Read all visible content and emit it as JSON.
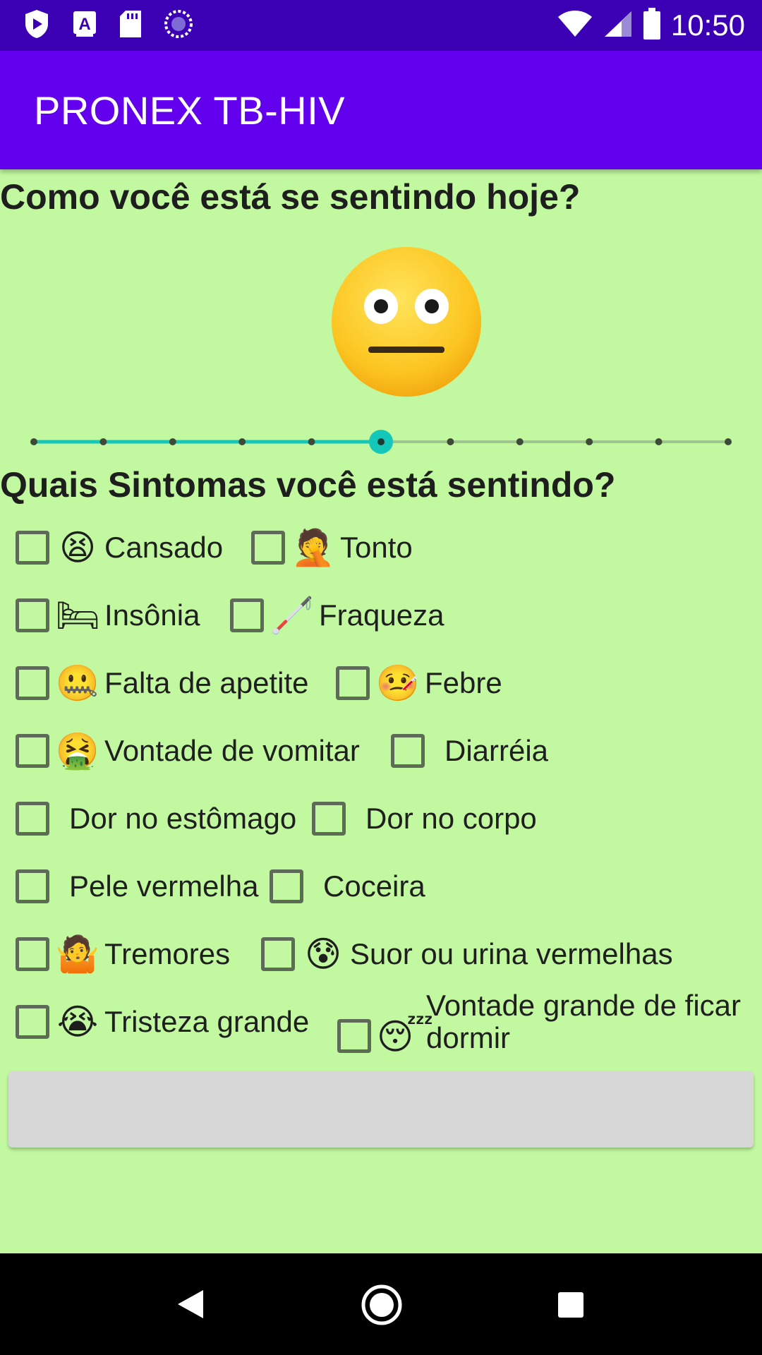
{
  "status_bar": {
    "time": "10:50",
    "icons": [
      "play-protect-icon",
      "a-keyboard-icon",
      "sd-card-icon",
      "sync-icon",
      "wifi-icon",
      "signal-icon",
      "battery-icon"
    ]
  },
  "app_bar": {
    "title": "PRONEX TB-HIV"
  },
  "feeling": {
    "question": "Como você está se sentindo hoje?",
    "face_icon": "neutral-face-icon",
    "slider": {
      "steps": 11,
      "selected_index": 5,
      "active_color": "#14c7b8"
    }
  },
  "symptoms": {
    "question": "Quais Sintomas você está  sentindo?",
    "items": [
      {
        "label": "Cansado",
        "emoji": "😫",
        "icon": "tired-face-icon",
        "checked": false
      },
      {
        "label": "Tonto",
        "emoji": "🤦",
        "icon": "dizzy-person-icon",
        "checked": false
      },
      {
        "label": "Insônia",
        "emoji": "🛏",
        "icon": "bed-icon",
        "checked": false
      },
      {
        "label": "Fraqueza",
        "emoji": "🦯",
        "icon": "cane-icon",
        "checked": false
      },
      {
        "label": "Falta de apetite",
        "emoji": "🤐",
        "icon": "zipper-mouth-icon",
        "checked": false
      },
      {
        "label": "Febre",
        "emoji": "🤒",
        "icon": "fever-person-icon",
        "checked": false
      },
      {
        "label": "Vontade de vomitar",
        "emoji": "🤮",
        "icon": "vomiting-face-icon",
        "checked": false
      },
      {
        "label": "Diarréia",
        "emoji": "",
        "icon": "",
        "checked": false
      },
      {
        "label": "Dor no estômago",
        "emoji": "",
        "icon": "",
        "checked": false
      },
      {
        "label": "Dor no corpo",
        "emoji": "",
        "icon": "",
        "checked": false
      },
      {
        "label": "Pele vermelha",
        "emoji": "",
        "icon": "",
        "checked": false
      },
      {
        "label": "Coceira",
        "emoji": "",
        "icon": "",
        "checked": false
      },
      {
        "label": "Tremores",
        "emoji": "🤷",
        "icon": "shivering-person-icon",
        "checked": false
      },
      {
        "label": "Suor ou urina vermelhas",
        "emoji": "😰",
        "icon": "sweating-face-icon",
        "checked": false
      },
      {
        "label": "Tristeza grande",
        "emoji": "😭",
        "icon": "crying-face-icon",
        "checked": false
      },
      {
        "label": "Vontade grande de ficar dormir",
        "emoji": "😴",
        "icon": "sleeping-face-icon",
        "checked": false
      }
    ]
  },
  "submit_button": {
    "label": ""
  }
}
